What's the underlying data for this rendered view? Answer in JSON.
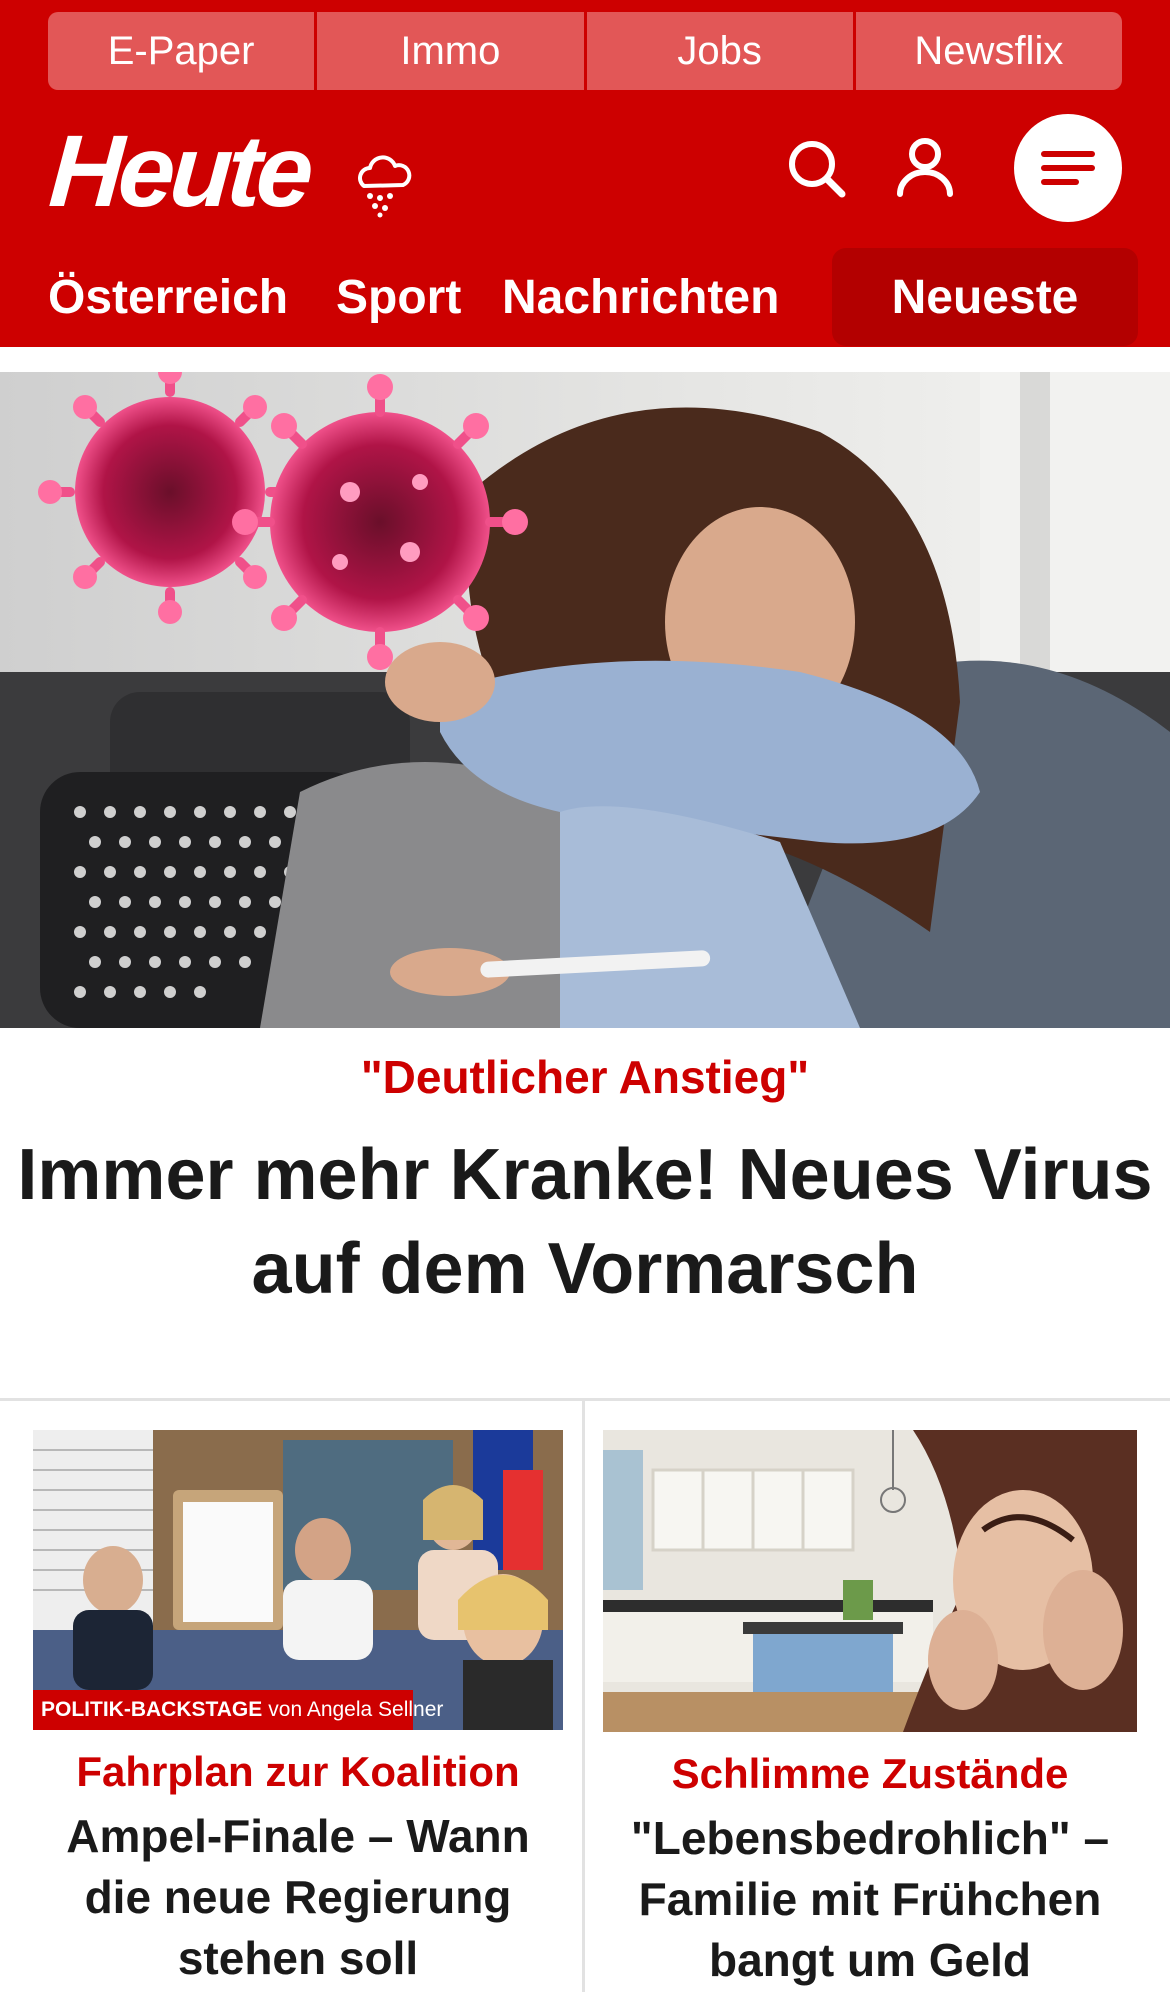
{
  "top_nav": [
    "E-Paper",
    "Immo",
    "Jobs",
    "Newsflix"
  ],
  "logo_text": "Heute",
  "header_icons": [
    "weather-rain-icon",
    "search-icon",
    "user-icon",
    "menu-icon"
  ],
  "section_nav": {
    "items": [
      "Österreich",
      "Sport",
      "Nachrichten"
    ],
    "active": "Neueste"
  },
  "hero": {
    "kicker": "\"Deutlicher Anstieg\"",
    "title": "Immer mehr Kranke! Neues Virus auf dem Vormarsch"
  },
  "teasers": [
    {
      "label": "POLITIK-BACKSTAGE",
      "label_by": "von Angela Sellner",
      "kicker": "Fahrplan zur Koalition",
      "title": "Ampel-Finale – Wann die neue Regierung stehen soll"
    },
    {
      "kicker": "Schlimme Zustände",
      "title": "\"Lebensbedrohlich\" – Familie mit Frühchen bangt um Geld"
    }
  ],
  "colors": {
    "brand_red": "#cd0000",
    "nav_tab": "#e25757",
    "active_tab": "#b30000"
  }
}
